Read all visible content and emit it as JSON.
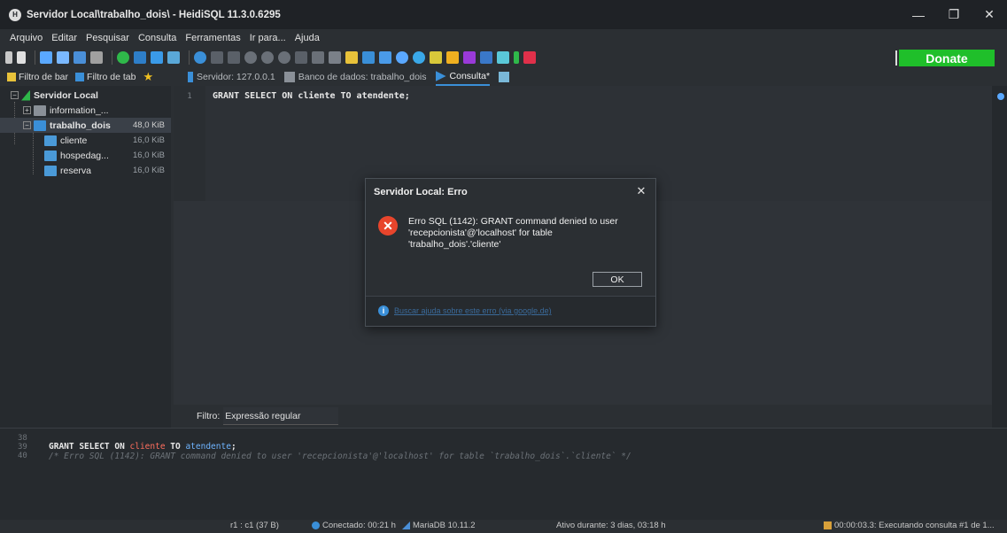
{
  "window": {
    "title": "Servidor Local\\trabalho_dois\\ - HeidiSQL 11.3.0.6295",
    "minimize": "—",
    "maximize": "❐",
    "close": "✕"
  },
  "menu": [
    "Arquivo",
    "Editar",
    "Pesquisar",
    "Consulta",
    "Ferramentas",
    "Ir para...",
    "Ajuda"
  ],
  "toolbar": {
    "donate_label": "Donate",
    "icons": [
      "edit-icon",
      "copy-icon",
      "undo-icon",
      "refresh-icon",
      "connect-icon",
      "database-icon",
      "table-icon",
      "run-icon",
      "first-icon",
      "last-icon",
      "add-icon",
      "remove-icon",
      "apply-icon",
      "cancel-icon",
      "execute-icon",
      "stop-icon",
      "folder-icon",
      "save-icon",
      "search-icon",
      "tools-icon",
      "warning-icon",
      "format-icon",
      "flash-icon",
      "close-icon"
    ]
  },
  "filterbar": {
    "filter_bar": "Filtro de bar",
    "filter_tab": "Filtro de tab",
    "tabs": [
      {
        "label": "Servidor: 127.0.0.1",
        "icon": "server-icon"
      },
      {
        "label": "Banco de dados: trabalho_dois",
        "icon": "database-icon"
      },
      {
        "label": "Consulta*",
        "icon": "query-icon"
      }
    ]
  },
  "tree": {
    "root": "Servidor Local",
    "nodes": [
      {
        "label": "information_...",
        "size": ""
      },
      {
        "label": "trabalho_dois",
        "size": "48,0 KiB"
      },
      {
        "label": "cliente",
        "size": "16,0 KiB"
      },
      {
        "label": "hospedag...",
        "size": "16,0 KiB"
      },
      {
        "label": "reserva",
        "size": "16,0 KiB"
      }
    ]
  },
  "editor": {
    "line_number": "1",
    "code": "GRANT SELECT ON cliente TO atendente;"
  },
  "filter": {
    "label": "Filtro:",
    "value": "Expressão regular"
  },
  "log": {
    "lines": [
      {
        "n": "38"
      },
      {
        "n": "39",
        "kw1": "GRANT SELECT ON ",
        "tbl": "cliente",
        "kw2": " TO ",
        "user": "atendente",
        "end": ";"
      },
      {
        "n": "40",
        "comment": "/* Erro SQL (1142): GRANT command denied to user 'recepcionista'@'localhost' for table `trabalho_dois`.`cliente` */"
      }
    ]
  },
  "status": {
    "position": "r1 : c1 (37 B)",
    "connected": "Conectado: 00:21 h",
    "server": "MariaDB 10.11.2",
    "uptime": "Ativo durante: 3 dias, 03:18 h",
    "executing": "00:00:03.3: Executando consulta #1 de 1..."
  },
  "dialog": {
    "title": "Servidor Local: Erro",
    "close": "✕",
    "message": "Erro SQL (1142): GRANT command denied to user 'recepcionista'@'localhost' for table 'trabalho_dois'.'cliente'",
    "ok_label": "OK",
    "help_link": "Buscar ajuda sobre este erro (via google.de)"
  },
  "colors": {
    "accent": "#3a8fd8",
    "donate": "#1fbf2a",
    "error": "#e8452c",
    "keyword_table": "#ff6e5e",
    "keyword_user": "#6fb4ff"
  }
}
